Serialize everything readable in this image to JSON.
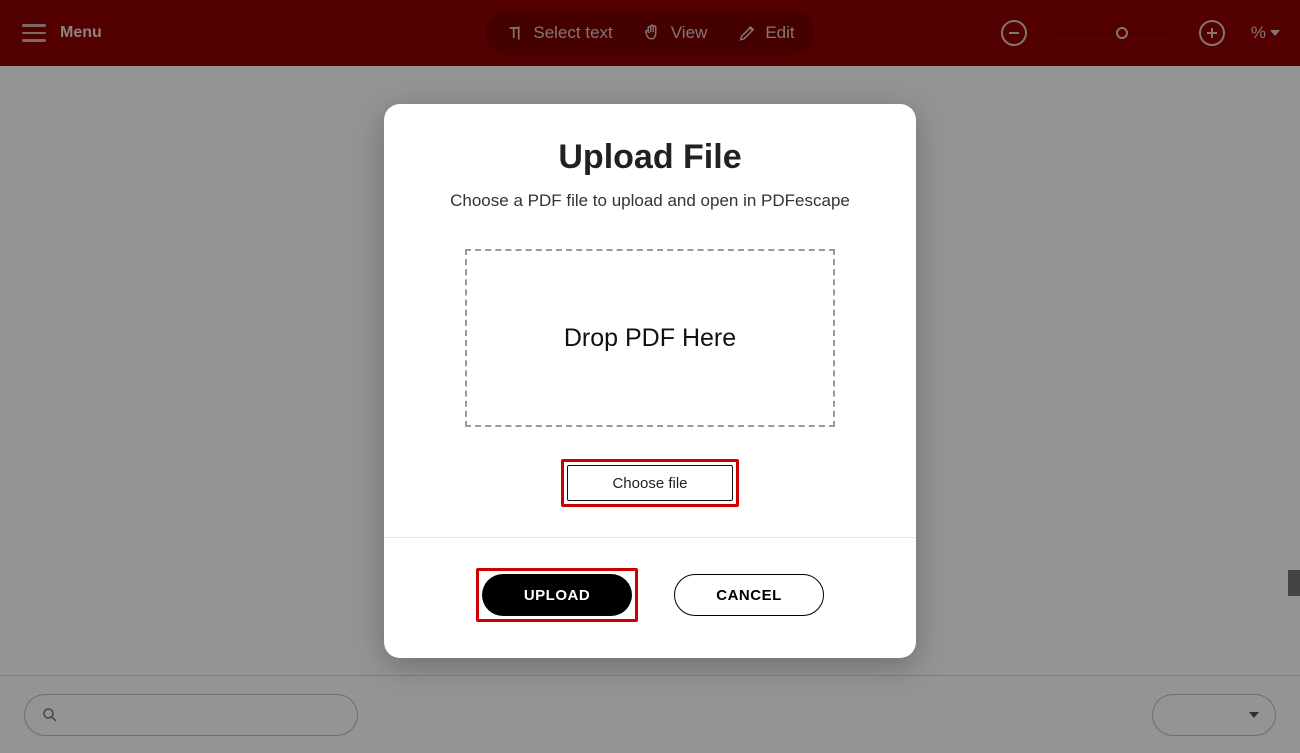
{
  "topbar": {
    "menu_label": "Menu",
    "modes": {
      "select_text": "Select text",
      "view": "View",
      "edit": "Edit"
    },
    "zoom_percent_label": "%"
  },
  "modal": {
    "title": "Upload File",
    "subtitle": "Choose a PDF file to upload and open in PDFescape",
    "dropzone_text": "Drop PDF Here",
    "choose_file_label": "Choose file",
    "upload_label": "UPLOAD",
    "cancel_label": "CANCEL"
  },
  "bottombar": {
    "search_placeholder": ""
  }
}
